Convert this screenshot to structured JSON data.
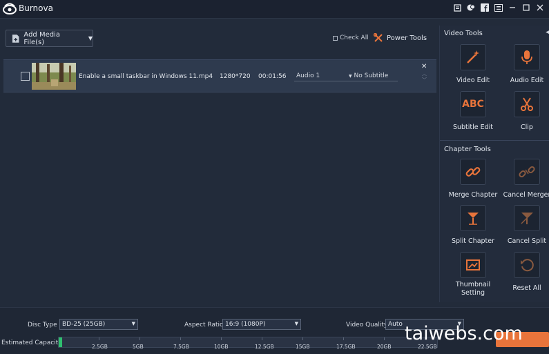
{
  "app": {
    "title": "Burnova"
  },
  "toolbar": {
    "add_media": "Add Media File(s)",
    "check_all": "Check All",
    "power_tools": "Power Tools"
  },
  "file": {
    "name": "Enable a small taskbar in Windows 11.mp4",
    "resolution": "1280*720",
    "duration": "00:01:56",
    "audio": "Audio 1",
    "subtitle": "No Subtitle"
  },
  "video_tools": {
    "title": "Video Tools",
    "items": [
      {
        "label": "Video Edit",
        "icon": "magic-wand-icon"
      },
      {
        "label": "Audio Edit",
        "icon": "microphone-icon"
      },
      {
        "label": "Subtitle Edit",
        "icon": "abc-text-icon",
        "glyph": "ABC"
      },
      {
        "label": "Clip",
        "icon": "scissors-icon"
      }
    ]
  },
  "chapter_tools": {
    "title": "Chapter Tools",
    "items": [
      {
        "label": "Merge Chapter",
        "icon": "link-icon"
      },
      {
        "label": "Cancel Merger",
        "icon": "broken-link-icon"
      },
      {
        "label": "Split Chapter",
        "icon": "split-icon"
      },
      {
        "label": "Cancel Split",
        "icon": "cancel-split-icon"
      },
      {
        "label": "Thumbnail Setting",
        "icon": "thumbnail-icon"
      },
      {
        "label": "Reset All",
        "icon": "reset-icon"
      }
    ]
  },
  "settings": {
    "disc_type_label": "Disc Type",
    "disc_type": "BD-25 (25GB)",
    "aspect_ratio_label": "Aspect Ratio:",
    "aspect_ratio": "16:9 (1080P)",
    "video_quality_label": "Video Quality:",
    "video_quality": "Auto",
    "capacity_label": "Estimated Capacity:",
    "capacity_fraction": 0.01,
    "ticks": [
      "2.5GB",
      "5GB",
      "7.5GB",
      "10GB",
      "12.5GB",
      "15GB",
      "17.5GB",
      "20GB",
      "22.5GB"
    ]
  },
  "watermark": "taiwebs.com",
  "colors": {
    "accent": "#e8743b",
    "capacity": "#2fbf6f",
    "background": "#222b3a"
  }
}
